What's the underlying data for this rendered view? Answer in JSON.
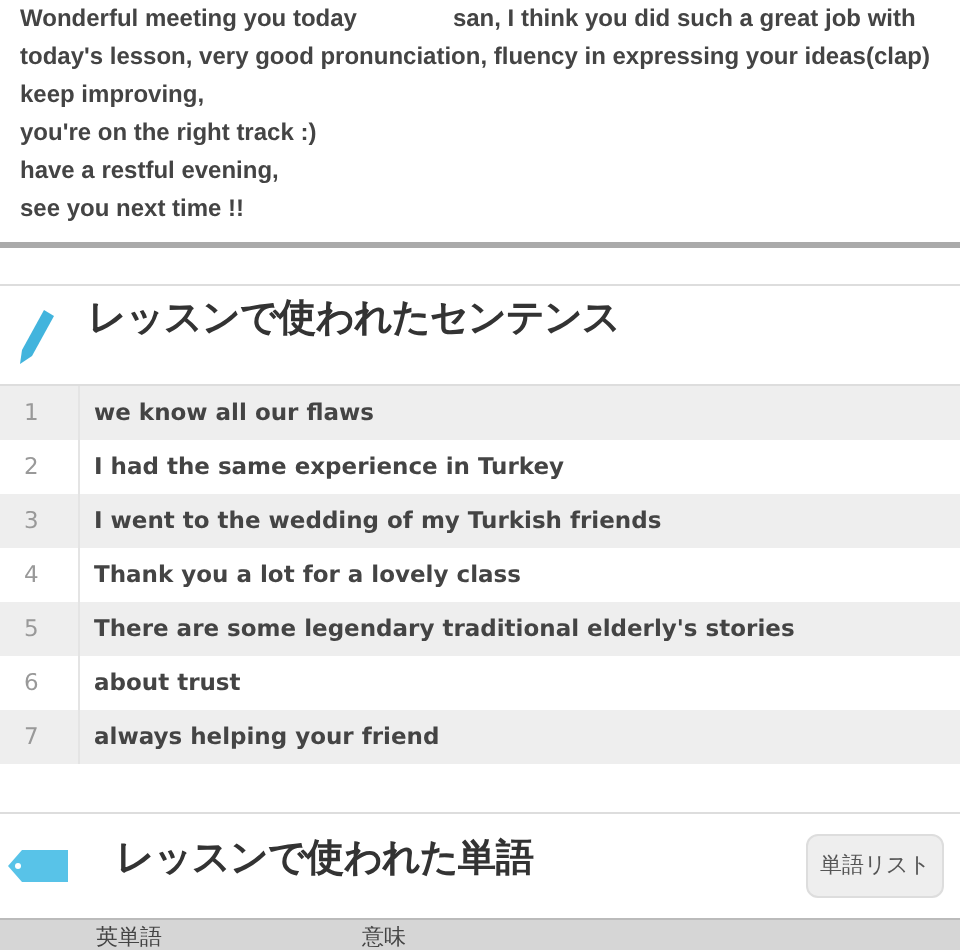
{
  "message": {
    "lines": [
      [
        "Wonderful meeting you today",
        "san, I think you did such a great job with"
      ],
      [
        "today's lesson, very good pronunciation, fluency in expressing your ideas(clap)"
      ],
      [
        "keep improving,"
      ],
      [
        "you're on the right track :)"
      ],
      [
        "have a restful evening,"
      ],
      [
        "see you next time !!"
      ]
    ]
  },
  "sentences": {
    "title": "レッスンで使われたセンテンス",
    "rows": [
      {
        "number": "1",
        "text": "we know all our flaws"
      },
      {
        "number": "2",
        "text": "I had the same experience in Turkey"
      },
      {
        "number": "3",
        "text": "I went to the wedding of my Turkish friends"
      },
      {
        "number": "4",
        "text": "Thank you a lot for a lovely class"
      },
      {
        "number": "5",
        "text": "There are some legendary traditional elderly's stories"
      },
      {
        "number": "6",
        "text": "about trust"
      },
      {
        "number": "7",
        "text": "always helping your friend"
      }
    ]
  },
  "words": {
    "title": "レッスンで使われた単語",
    "button": "単語リスト",
    "columns": [
      "英単語",
      "意味"
    ]
  }
}
